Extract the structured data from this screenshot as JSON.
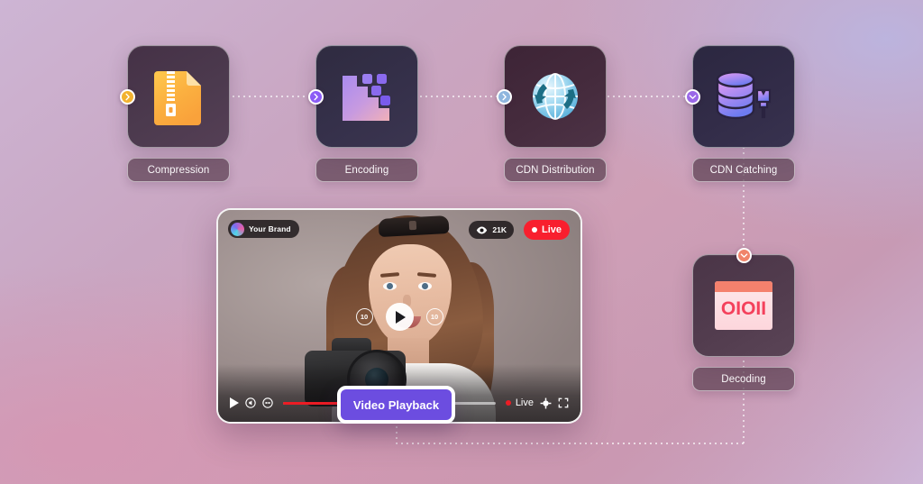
{
  "background": {
    "gradient_from": "#cdb5d4",
    "gradient_mid": "#cf9fb6",
    "gradient_to": "#cdb6d8"
  },
  "pipeline": {
    "nodes": [
      {
        "id": "compression",
        "label": "Compression",
        "icon": "zip-file-icon",
        "pin_color": "#f2b230",
        "pin_direction": "right"
      },
      {
        "id": "encoding",
        "label": "Encoding",
        "icon": "pixel-blocks-icon",
        "pin_color": "#8b5cf6",
        "pin_direction": "right"
      },
      {
        "id": "cdn-distribution",
        "label": "CDN Distribution",
        "icon": "globe-sync-icon",
        "pin_color": "#8fb6de",
        "pin_direction": "right"
      },
      {
        "id": "cdn-catching",
        "label": "CDN Catching",
        "icon": "database-brush-icon",
        "pin_color": "#9a67e8",
        "pin_direction": "down"
      },
      {
        "id": "decoding",
        "label": "Decoding",
        "icon": "binary-screen-icon",
        "pin_color": "#f0846a",
        "pin_direction": "down"
      }
    ]
  },
  "decoding_icon": {
    "binary_text": "OIOII",
    "header_color": "#f4816d",
    "digit_color": "#f4415c"
  },
  "player": {
    "brand": {
      "label": "Your Brand",
      "icon": "brand-avatar-icon"
    },
    "views": {
      "count": "21K",
      "icon": "eye-icon"
    },
    "live_badge": {
      "label": "Live",
      "color": "#f81f2e"
    },
    "center_controls": {
      "rewind_label": "10",
      "rewind_icon": "rewind-10-icon",
      "play_icon": "play-icon",
      "forward_label": "10",
      "forward_icon": "forward-10-icon"
    },
    "bottom_bar": {
      "play_icon": "play-icon",
      "mute_icon": "volume-icon",
      "cc_icon": "captions-icon",
      "progress_percent": 52,
      "progress_color": "#ec1c24",
      "live_label": "Live",
      "settings_icon": "gear-icon",
      "fullscreen_icon": "fullscreen-icon"
    },
    "cta": {
      "label": "Video Playback",
      "color": "#6c4de0"
    }
  }
}
